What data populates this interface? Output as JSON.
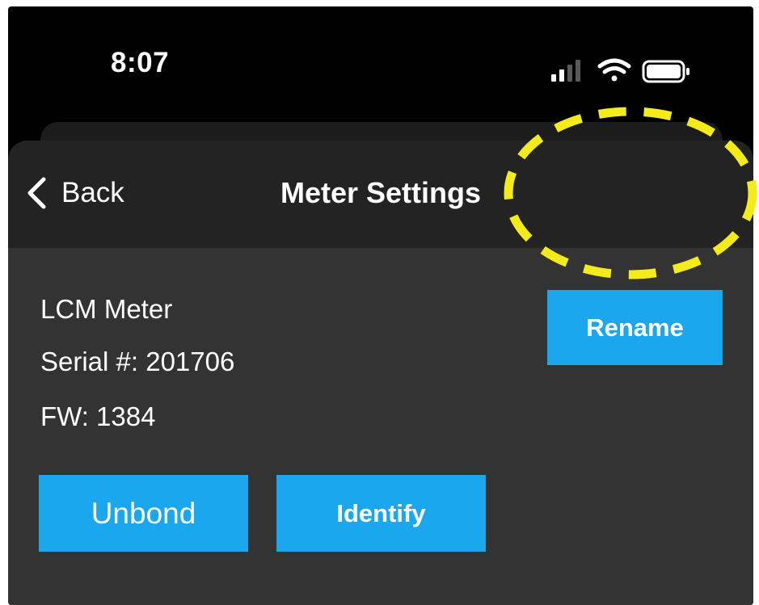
{
  "status_bar": {
    "time": "8:07",
    "icons": [
      "cellular-signal-icon",
      "wifi-icon",
      "battery-icon"
    ]
  },
  "nav": {
    "back_label": "Back",
    "title": "Meter Settings"
  },
  "meter": {
    "name": "LCM Meter",
    "serial": "Serial #: 201706",
    "firmware": "FW: 1384"
  },
  "buttons": {
    "rename": "Rename",
    "unbond": "Unbond",
    "identify": "Identify"
  },
  "colors": {
    "accent": "#1aa7ee",
    "highlight": "#f4ec1a",
    "sheet": "#333333",
    "nav_bar": "#232323",
    "background": "#000000"
  }
}
